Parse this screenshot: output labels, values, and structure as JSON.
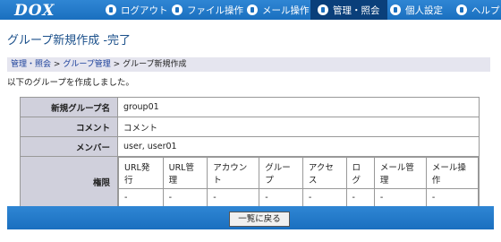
{
  "app": {
    "logo": "DOX"
  },
  "nav": [
    {
      "label": "ログアウト"
    },
    {
      "label": "ファイル操作"
    },
    {
      "label": "メール操作"
    },
    {
      "label": "管理・照会"
    },
    {
      "label": "個人設定"
    },
    {
      "label": "ヘルプ"
    }
  ],
  "page": {
    "title": "グループ新規作成 -完了",
    "breadcrumb": [
      "管理・照会",
      "グループ管理",
      "グループ新規作成"
    ],
    "message": "以下のグループを作成しました。"
  },
  "details": {
    "group_name_label": "新規グループ名",
    "group_name": "group01",
    "comment_label": "コメント",
    "comment": "コメント",
    "members_label": "メンバー",
    "members": "user, user01",
    "permissions_label": "権限",
    "permissions": [
      {
        "name": "URL発行",
        "value": "-"
      },
      {
        "name": "URL管理",
        "value": "-"
      },
      {
        "name": "アカウント",
        "value": "-"
      },
      {
        "name": "グループ",
        "value": "-"
      },
      {
        "name": "アクセス",
        "value": "-"
      },
      {
        "name": "ログ",
        "value": "-"
      },
      {
        "name": "メール管理",
        "value": "-"
      },
      {
        "name": "メール操作",
        "value": "-"
      }
    ]
  },
  "actions": {
    "back_label": "一覧に戻る"
  }
}
